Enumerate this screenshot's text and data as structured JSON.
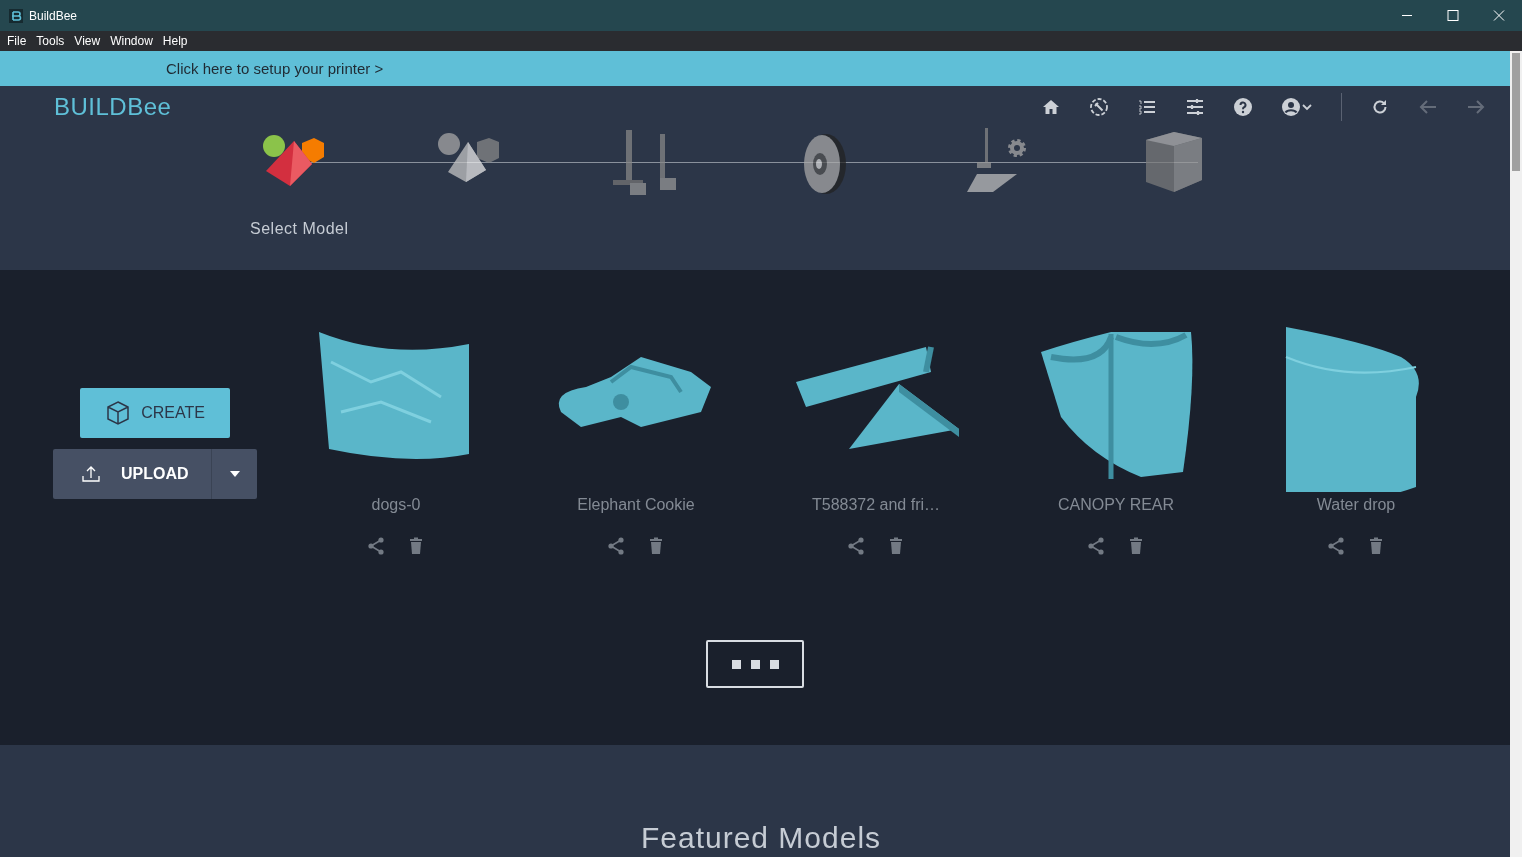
{
  "window": {
    "title": "BuildBee"
  },
  "menu": [
    "File",
    "Tools",
    "View",
    "Window",
    "Help"
  ],
  "banner": {
    "text": "Click here to setup your printer >"
  },
  "logo": "BUILDBee",
  "toolbar": [
    {
      "kind": "home",
      "disabled": false
    },
    {
      "kind": "wrench",
      "disabled": false
    },
    {
      "kind": "list",
      "disabled": false
    },
    {
      "kind": "sliders",
      "disabled": false
    },
    {
      "kind": "help",
      "disabled": false
    },
    {
      "kind": "account",
      "disabled": false
    },
    {
      "kind": "refresh",
      "disabled": false
    },
    {
      "kind": "back",
      "disabled": true
    },
    {
      "kind": "forward",
      "disabled": true
    }
  ],
  "steps": [
    {
      "kind": "model",
      "label": "Select Model",
      "selected": true
    },
    {
      "kind": "transform",
      "selected": false
    },
    {
      "kind": "supports",
      "selected": false
    },
    {
      "kind": "material",
      "selected": false
    },
    {
      "kind": "printer",
      "selected": false
    },
    {
      "kind": "print",
      "selected": false
    }
  ],
  "actions": {
    "create": "CREATE",
    "upload": "UPLOAD"
  },
  "models": [
    {
      "name": "dogs-0",
      "kind": "panel"
    },
    {
      "name": "Elephant Cookie",
      "kind": "cookie"
    },
    {
      "name": "T588372 and fri…",
      "kind": "wedge"
    },
    {
      "name": "CANOPY REAR",
      "kind": "canopy"
    },
    {
      "name": "Water drop",
      "kind": "drop"
    }
  ],
  "featured": {
    "title": "Featured Models"
  }
}
